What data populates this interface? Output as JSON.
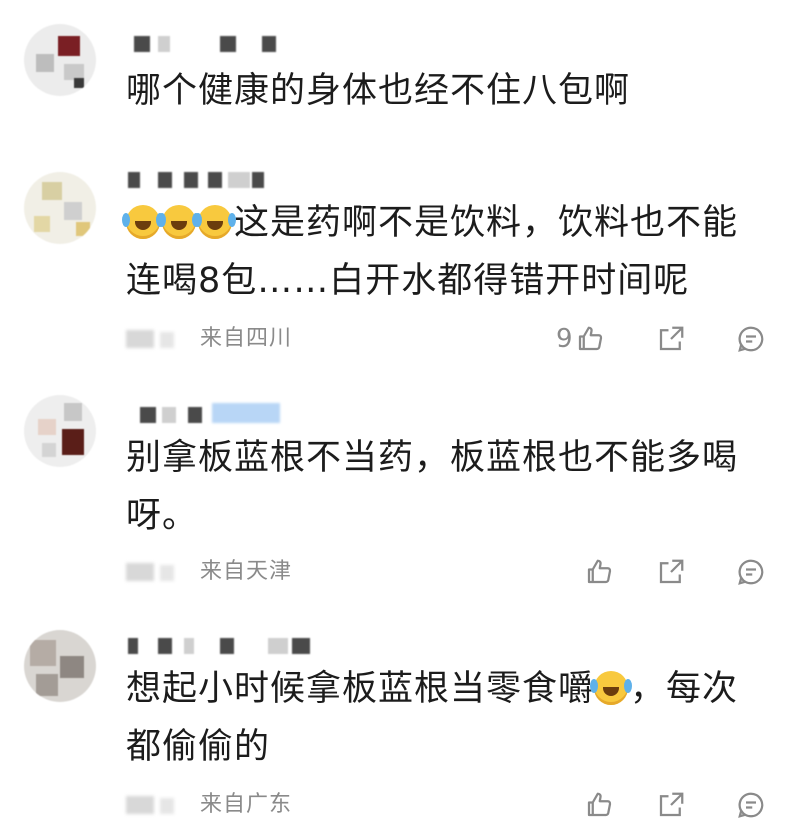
{
  "comments": [
    {
      "text": "哪个健康的身体也经不住八包啊",
      "location": "",
      "likes": ""
    },
    {
      "text": "这是药啊不是饮料，饮料也不能连喝8包……白开水都得错开时间呢",
      "location": "来自四川",
      "likes": "9"
    },
    {
      "text": "别拿板蓝根不当药，板蓝根也不能多喝呀。",
      "location": "来自天津",
      "likes": ""
    },
    {
      "text_before": "想起小时候拿板蓝根当零食嚼",
      "text_after": "，每次都偷偷的",
      "location": "来自广东",
      "likes": ""
    }
  ],
  "icons": {
    "emoji": "laugh-cry-emoji",
    "like": "thumbs-up-icon",
    "share": "share-icon",
    "reply": "comment-icon"
  }
}
